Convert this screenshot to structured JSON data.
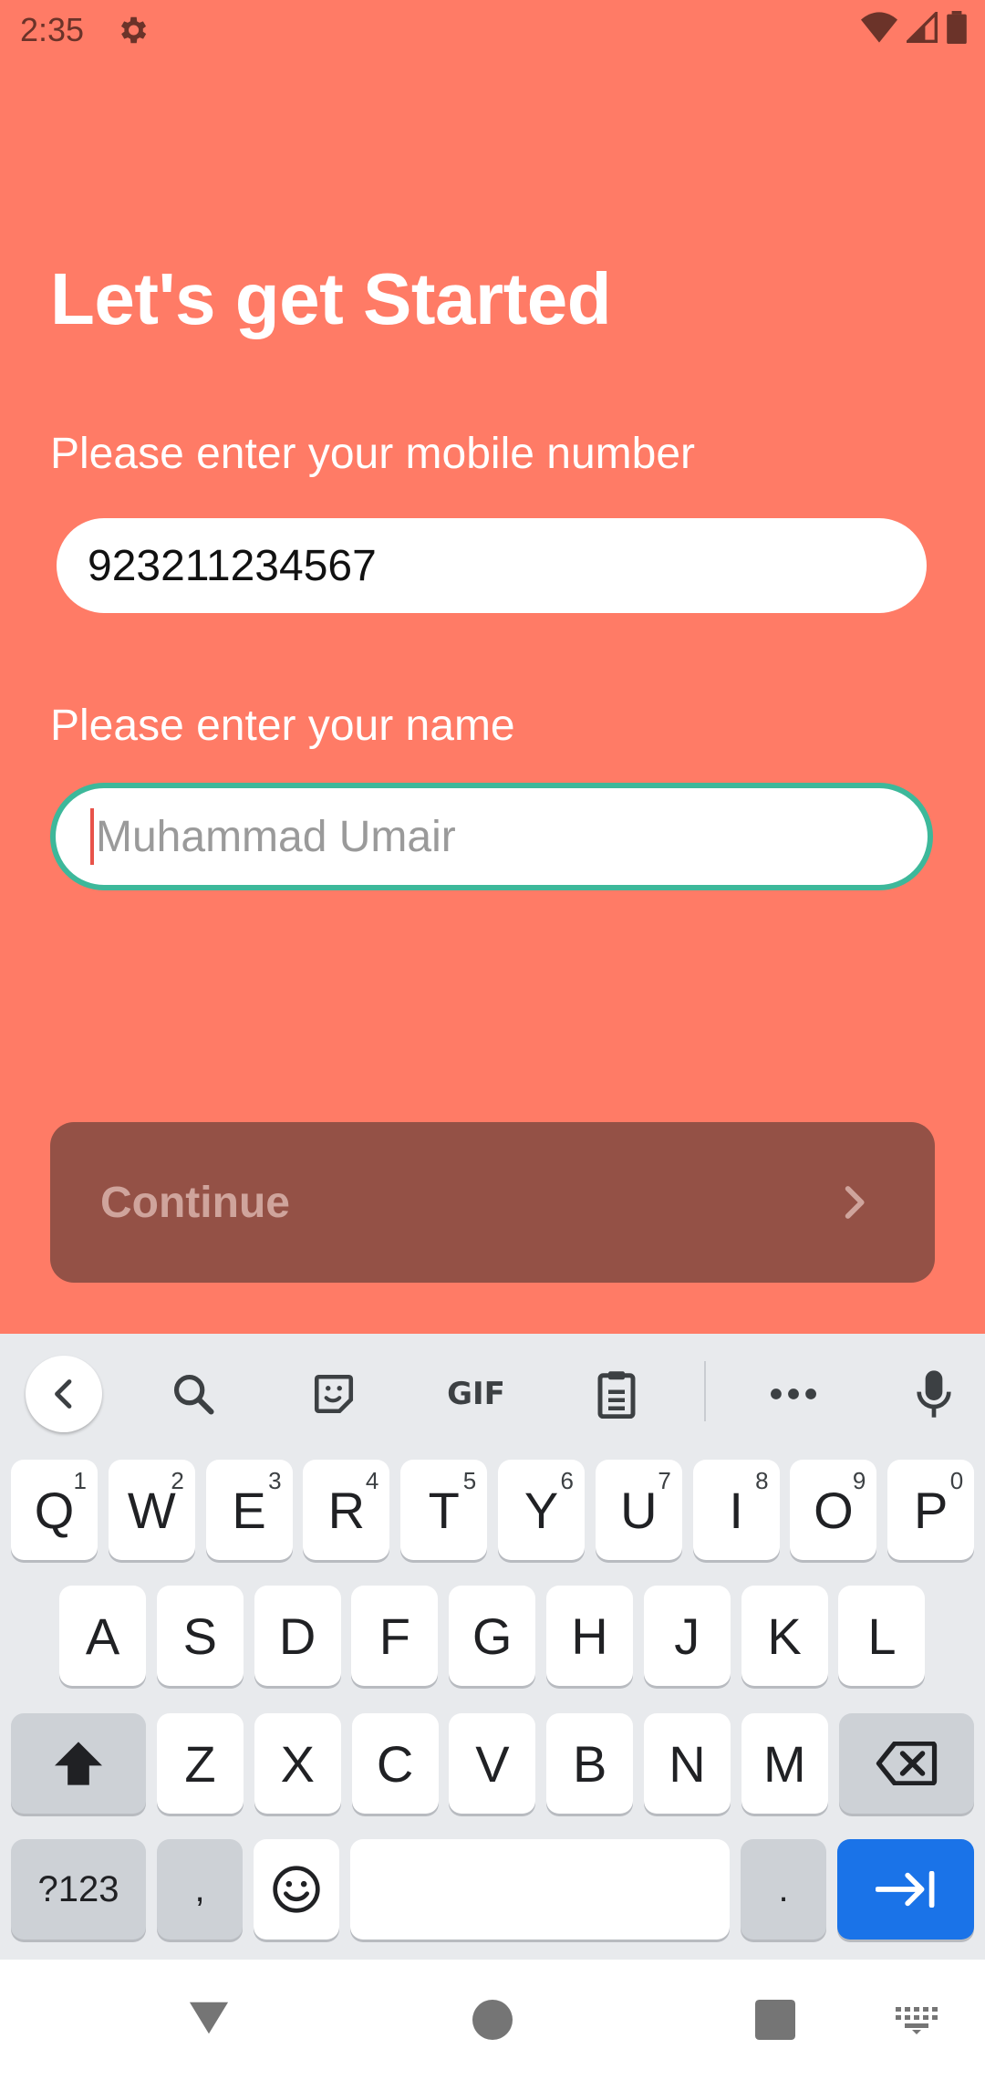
{
  "status_bar": {
    "time": "2:35",
    "icons": [
      "gear-icon",
      "wifi-icon",
      "signal-icon",
      "battery-icon"
    ]
  },
  "page": {
    "title": "Let's get Started",
    "mobile_label": "Please enter your mobile number",
    "mobile_value": "923211234567",
    "name_label": "Please enter your name",
    "name_placeholder": "Muhammad Umair",
    "continue_label": "Continue"
  },
  "colors": {
    "background": "#FF7B66",
    "focus_border": "#3DB89A",
    "continue_button": "#945146",
    "enter_key": "#1A73E8"
  },
  "keyboard": {
    "toolbar": [
      "back-icon",
      "search-icon",
      "sticker-icon",
      "gif-icon",
      "clipboard-icon",
      "more-icon",
      "microphone-icon"
    ],
    "gif_label": "GIF",
    "row1": [
      {
        "k": "Q",
        "h": "1"
      },
      {
        "k": "W",
        "h": "2"
      },
      {
        "k": "E",
        "h": "3"
      },
      {
        "k": "R",
        "h": "4"
      },
      {
        "k": "T",
        "h": "5"
      },
      {
        "k": "Y",
        "h": "6"
      },
      {
        "k": "U",
        "h": "7"
      },
      {
        "k": "I",
        "h": "8"
      },
      {
        "k": "O",
        "h": "9"
      },
      {
        "k": "P",
        "h": "0"
      }
    ],
    "row2": [
      "A",
      "S",
      "D",
      "F",
      "G",
      "H",
      "J",
      "K",
      "L"
    ],
    "row3": [
      "Z",
      "X",
      "C",
      "V",
      "B",
      "N",
      "M"
    ],
    "symbols_label": "?123",
    "comma_label": ",",
    "period_label": "."
  },
  "nav_bar": {
    "icons": [
      "back-triangle-icon",
      "home-circle-icon",
      "recents-square-icon",
      "keyboard-switch-icon"
    ]
  }
}
